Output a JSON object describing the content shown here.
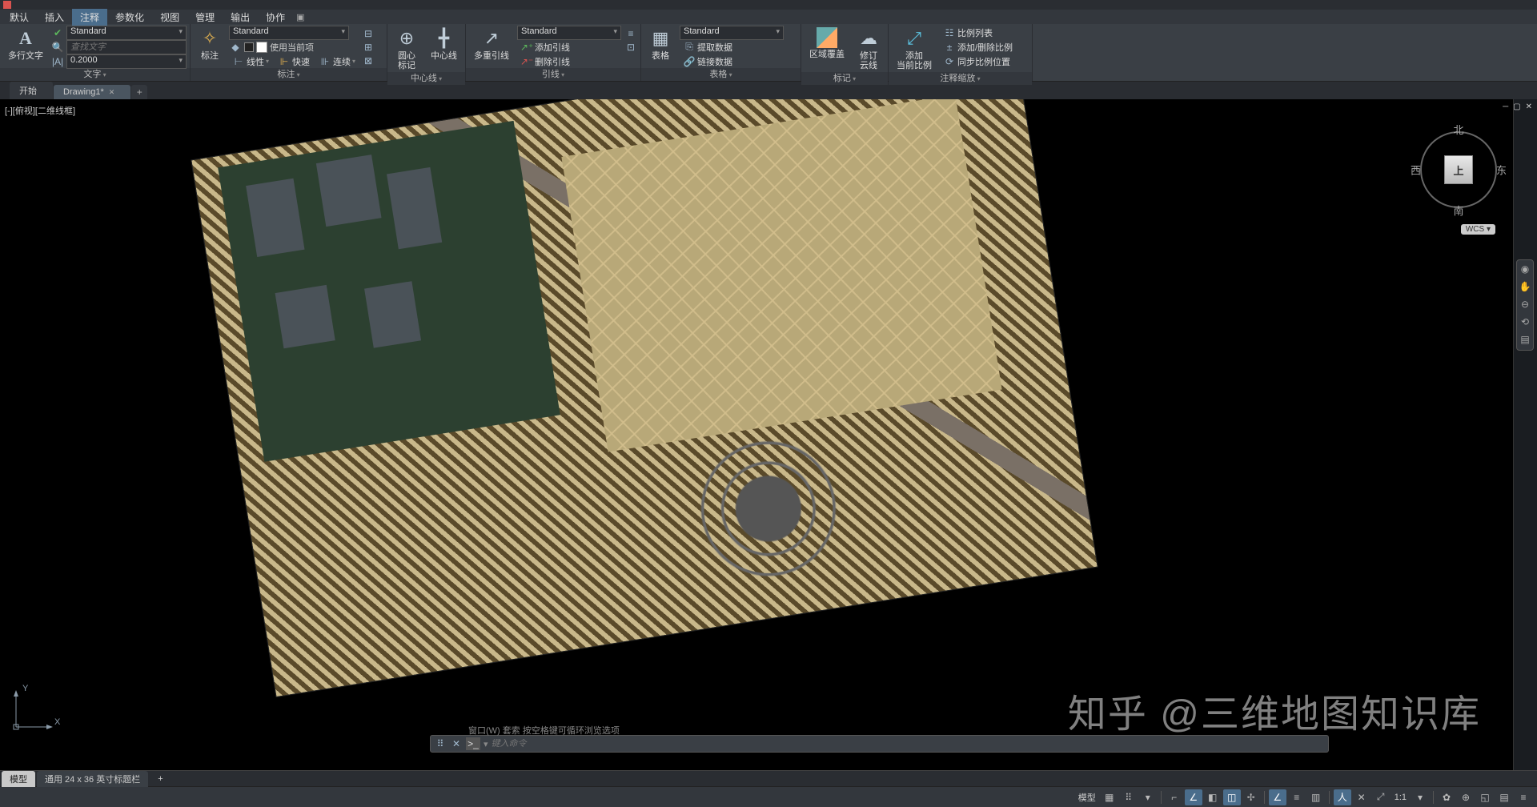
{
  "menubar": {
    "items": [
      "默认",
      "插入",
      "注释",
      "参数化",
      "视图",
      "管理",
      "输出",
      "协作"
    ],
    "active_index": 2,
    "extra_icon": "▣"
  },
  "ribbon": {
    "text_panel": {
      "title": "文字",
      "big_button": "多行文字",
      "style_dd": "Standard",
      "find_placeholder": "查找文字",
      "height": "0.2000"
    },
    "dim_panel": {
      "title": "标注",
      "big_button": "标注",
      "style_dd": "Standard",
      "use_current": "使用当前项",
      "linear": "线性",
      "quick": "快速",
      "continue": "连续"
    },
    "center_panel": {
      "title": "中心线",
      "b1": "圆心\n标记",
      "b2": "中心线"
    },
    "leader_panel": {
      "title": "引线",
      "big_button": "多重引线",
      "style_dd": "Standard",
      "add": "添加引线",
      "remove": "删除引线"
    },
    "table_panel": {
      "title": "表格",
      "big_button": "表格",
      "style_dd": "Standard",
      "extract": "提取数据",
      "link": "链接数据"
    },
    "markup_panel": {
      "title": "标记",
      "b1": "区域覆盖",
      "b2": "修订\n云线"
    },
    "scale_panel": {
      "title": "注释缩放",
      "big_button": "添加\n当前比例",
      "r1": "比例列表",
      "r2": "添加/删除比例",
      "r3": "同步比例位置"
    }
  },
  "doc_tabs": {
    "tabs": [
      {
        "label": "开始",
        "active": false
      },
      {
        "label": "Drawing1*",
        "active": true
      }
    ]
  },
  "viewport": {
    "label": "[-][俯视][二维线框]",
    "viewcube": {
      "top": "上",
      "n": "北",
      "s": "南",
      "e": "东",
      "w": "西"
    },
    "wcs": "WCS",
    "ucs": {
      "x": "X",
      "y": "Y"
    }
  },
  "command": {
    "history": "窗口(W) 套索   按空格键可循环浏览选项",
    "placeholder": "键入命令"
  },
  "layout_tabs": {
    "tabs": [
      {
        "label": "模型",
        "active": true
      },
      {
        "label": "通用 24 x 36 英寸标题栏",
        "active": false
      }
    ]
  },
  "statusbar": {
    "model": "模型",
    "scale": "1:1"
  },
  "watermark": "知乎 @三维地图知识库"
}
